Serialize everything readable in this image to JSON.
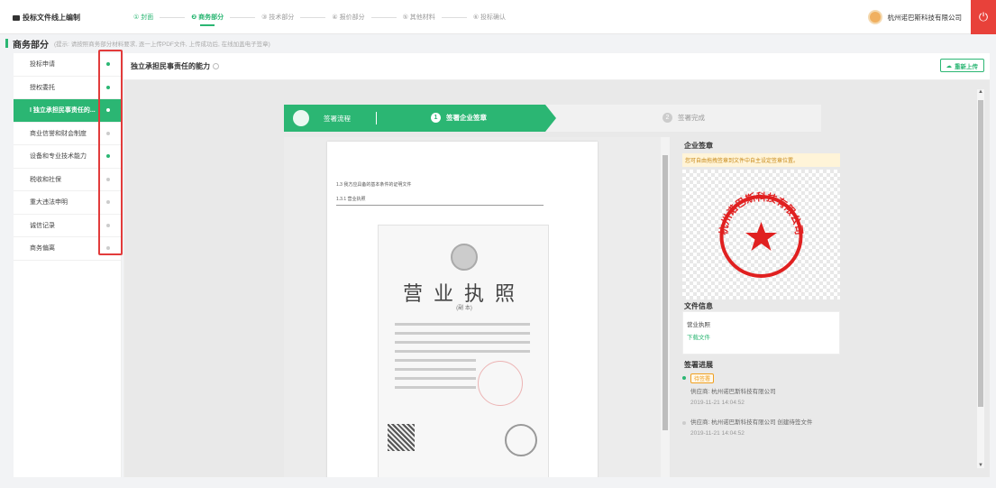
{
  "header": {
    "app_title": "投标文件线上编制",
    "steps": [
      {
        "label": "① 封面",
        "state": "done"
      },
      {
        "label": "❷ 商务部分",
        "state": "active"
      },
      {
        "label": "③ 技术部分",
        "state": "inactive"
      },
      {
        "label": "④ 报价部分",
        "state": "inactive"
      },
      {
        "label": "⑤ 其他材料",
        "state": "inactive"
      },
      {
        "label": "⑥ 投标确认",
        "state": "inactive"
      }
    ],
    "company": "杭州诺巴斯科技有限公司",
    "power_icon": "power-icon"
  },
  "section": {
    "title": "商务部分",
    "hint": "(提示: 请按照商务部分材料要求, 逐一上传PDF文件, 上传成功后, 在线加盖电子签章)"
  },
  "sidebar": {
    "items": [
      {
        "label": "投标申请",
        "status": "done"
      },
      {
        "label": "授权委托",
        "status": "done"
      },
      {
        "label": "I 独立承担民事责任的...",
        "status": "active"
      },
      {
        "label": "商业信誉和财会制度",
        "status": "pending"
      },
      {
        "label": "设备和专业技术能力",
        "status": "done"
      },
      {
        "label": "税收和社保",
        "status": "pending"
      },
      {
        "label": "重大违法申明",
        "status": "pending"
      },
      {
        "label": "诚信记录",
        "status": "pending"
      },
      {
        "label": "商务偏离",
        "status": "pending"
      }
    ]
  },
  "main": {
    "title": "独立承担民事责任的能力",
    "reupload": "重新上传"
  },
  "flow": {
    "label": "签署流程",
    "step1": "签署企业签章",
    "step1_num": "1",
    "step2": "签署完成",
    "step2_num": "2"
  },
  "document": {
    "line1": "1.3 我方应具备的基本条件的证明文件",
    "line2": "1.3.1 营业执照",
    "license_title": "营业执照",
    "license_sub": "(副 本)"
  },
  "right_panel": {
    "seal_title": "企业签章",
    "seal_notice": "您可自由拖拽签章到文件中自主设定签章位置。",
    "seal_text": "杭州诺巴斯科技有限公司",
    "file_title": "文件信息",
    "file_name": "营业执照",
    "file_download": "下载文件",
    "progress_title": "签署进展",
    "progress": [
      {
        "badge": "待签署",
        "text": "供应商: 杭州诺巴斯科技有限公司",
        "time": "2019-11-21 14:04:52"
      },
      {
        "badge": "",
        "text": "供应商: 杭州诺巴斯科技有限公司 创建待签文件",
        "time": "2019-11-21 14:04:52"
      }
    ]
  },
  "colors": {
    "accent": "#2bb673",
    "danger": "#e8413a",
    "seal_red": "#e02020",
    "warning": "#f0a020"
  }
}
